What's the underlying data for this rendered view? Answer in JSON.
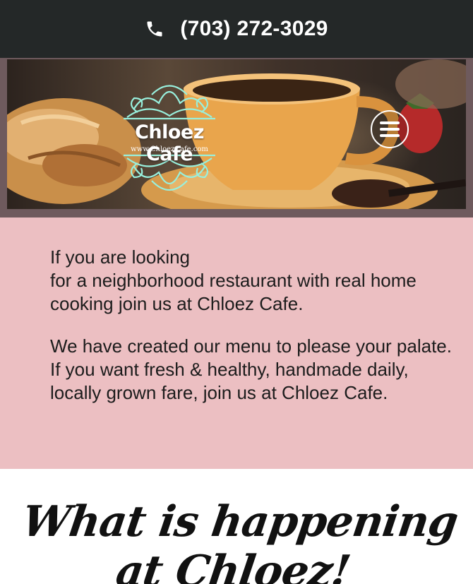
{
  "topbar": {
    "phone_icon": "phone-icon",
    "phone_number": "(703) 272-3029"
  },
  "header": {
    "logo_title": "Chloez Cafe",
    "logo_url": "www.ChloezCafe.com",
    "logo_color": "#98f0dd",
    "menu_icon": "hamburger-menu-icon"
  },
  "intro": {
    "paragraph_1_line_1": "If you are looking",
    "paragraph_1_line_2": "for a neighborhood restaurant with real home cooking join us at Chloez Cafe.",
    "paragraph_2": "We have created our menu to please your palate.  If you want fresh & healthy, handmade daily, locally grown fare, join us at Chloez Cafe."
  },
  "happening": {
    "title": "What is happening at Chloez!"
  },
  "colors": {
    "topbar_bg": "#242828",
    "intro_bg": "#ecbfc2",
    "hero_frame": "#6e5a5d"
  }
}
